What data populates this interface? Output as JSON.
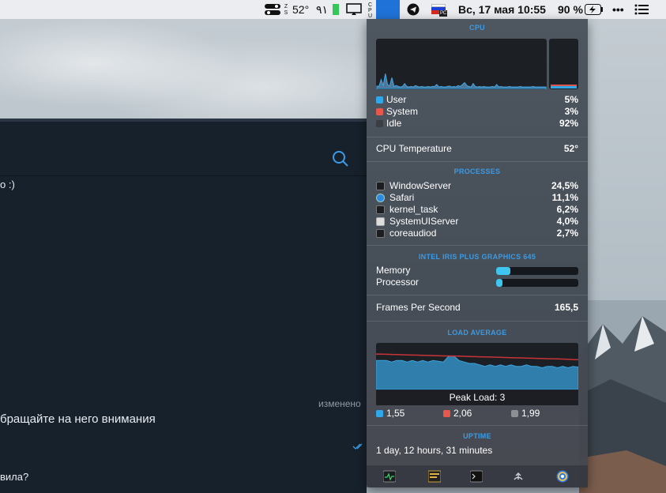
{
  "menubar": {
    "temperature": "52°",
    "number_glyph": "٩١",
    "input_flag_label": "РС",
    "datetime": "Вс, 17 мая  10:55",
    "battery": "90 %",
    "more": "•••"
  },
  "chat": {
    "line1": "о :)",
    "edited": "изменено",
    "message": "бращайте на него внимания",
    "line_bottom": "вила?"
  },
  "panel": {
    "cpu": {
      "title": "CPU",
      "rows": [
        {
          "label": "User",
          "value": "5%",
          "color": "#2fa7e8"
        },
        {
          "label": "System",
          "value": "3%",
          "color": "#e8574c"
        },
        {
          "label": "Idle",
          "value": "92%",
          "color": "#3a3d42"
        }
      ],
      "history_user": [
        5,
        4,
        18,
        6,
        30,
        8,
        5,
        22,
        4,
        6,
        4,
        3,
        4,
        10,
        4,
        3,
        4,
        3,
        6,
        4,
        3,
        4,
        3,
        3,
        4,
        3,
        4,
        4,
        8,
        3,
        4,
        3,
        3,
        4,
        5,
        3,
        4,
        3,
        6,
        4,
        8,
        12,
        6,
        4,
        3,
        10,
        4,
        3,
        4,
        3,
        4,
        3,
        3,
        3,
        4,
        3,
        8,
        3,
        4,
        3,
        3,
        3,
        4,
        3,
        3,
        3,
        3,
        4,
        3,
        3,
        3,
        3,
        3,
        4,
        3,
        3,
        3,
        3,
        3,
        3
      ],
      "history_system": [
        3,
        3,
        6,
        3,
        8,
        4,
        3,
        6,
        3,
        3,
        3,
        2,
        3,
        4,
        3,
        2,
        3,
        2,
        3,
        3,
        2,
        3,
        2,
        2,
        3,
        2,
        3,
        3,
        4,
        2,
        3,
        2,
        2,
        3,
        3,
        2,
        3,
        2,
        3,
        3,
        4,
        5,
        3,
        3,
        2,
        4,
        3,
        2,
        3,
        2,
        3,
        2,
        2,
        2,
        3,
        2,
        3,
        2,
        3,
        2,
        2,
        2,
        3,
        2,
        2,
        2,
        2,
        3,
        2,
        2,
        2,
        2,
        2,
        3,
        2,
        2,
        2,
        2,
        2,
        2
      ]
    },
    "cpu_temp": {
      "label": "CPU Temperature",
      "value": "52°"
    },
    "processes": {
      "title": "PROCESSES",
      "rows": [
        {
          "name": "WindowServer",
          "value": "24,5%",
          "icon": "terminal-icon"
        },
        {
          "name": "Safari",
          "value": "11,1%",
          "icon": "safari-icon"
        },
        {
          "name": "kernel_task",
          "value": "6,2%",
          "icon": "terminal-icon"
        },
        {
          "name": "SystemUIServer",
          "value": "4,0%",
          "icon": "document-icon"
        },
        {
          "name": "coreaudiod",
          "value": "2,7%",
          "icon": "terminal-icon"
        }
      ]
    },
    "gpu": {
      "title": "INTEL IRIS PLUS GRAPHICS 645",
      "memory_label": "Memory",
      "memory_level": 0.17,
      "processor_label": "Processor",
      "processor_level": 0.08
    },
    "fps": {
      "label": "Frames Per Second",
      "value": "165,5"
    },
    "load": {
      "title": "LOAD AVERAGE",
      "peak_label": "Peak Load: 3",
      "max": 3,
      "values": [
        {
          "value": "1,55",
          "color": "#2fa7e8"
        },
        {
          "value": "2,06",
          "color": "#e8574c"
        },
        {
          "value": "1,99",
          "color": "#8c8f94"
        }
      ],
      "history_1m": [
        2.0,
        2.0,
        2.0,
        1.9,
        2.0,
        2.0,
        1.9,
        2.0,
        1.9,
        2.0,
        1.9,
        2.0,
        1.95,
        1.9,
        2.3,
        2.3,
        2.0,
        1.9,
        1.8,
        1.8,
        1.7,
        1.6,
        1.7,
        1.6,
        1.7,
        1.6,
        1.7,
        1.6,
        1.6,
        1.7,
        1.6,
        1.6,
        1.5,
        1.6,
        1.6,
        1.5,
        1.6,
        1.5,
        1.6,
        1.55
      ],
      "history_5m": [
        2.45,
        2.44,
        2.43,
        2.42,
        2.41,
        2.4,
        2.39,
        2.38,
        2.37,
        2.36,
        2.35,
        2.34,
        2.33,
        2.32,
        2.32,
        2.31,
        2.3,
        2.29,
        2.28,
        2.27,
        2.26,
        2.25,
        2.24,
        2.23,
        2.22,
        2.21,
        2.2,
        2.19,
        2.18,
        2.17,
        2.16,
        2.15,
        2.14,
        2.13,
        2.12,
        2.11,
        2.1,
        2.09,
        2.07,
        2.06
      ]
    },
    "uptime": {
      "title": "UPTIME",
      "value": "1 day, 12 hours, 31 minutes"
    },
    "toolbar_icons": [
      "activity-monitor-icon",
      "console-icon",
      "terminal-icon",
      "network-icon",
      "settings-icon"
    ]
  }
}
